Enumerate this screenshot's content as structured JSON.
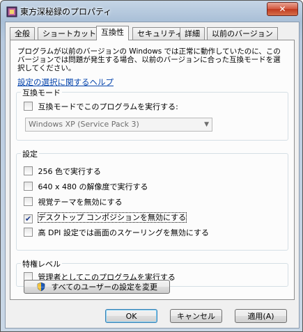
{
  "window": {
    "title": "東方深秘録のプロパティ",
    "close_label": "✕"
  },
  "tabs": [
    {
      "label": "全般"
    },
    {
      "label": "ショートカット"
    },
    {
      "label": "互換性"
    },
    {
      "label": "セキュリティ"
    },
    {
      "label": "詳細"
    },
    {
      "label": "以前のバージョン"
    }
  ],
  "compat": {
    "description": "プログラムが以前のバージョンの Windows では正常に動作していたのに、このバージョンでは問題が発生する場合、以前のバージョンに合った互換モードを選択してください。",
    "help_link": "設定の選択に関するヘルプ",
    "mode_group": {
      "label": "互換モード",
      "checkbox_label": "互換モードでこのプログラムを実行する:",
      "checked": false,
      "selected_os": "Windows XP (Service Pack 3)"
    },
    "settings_group": {
      "label": "設定",
      "items": [
        {
          "label": "256 色で実行する",
          "checked": false
        },
        {
          "label": "640 x 480 の解像度で実行する",
          "checked": false
        },
        {
          "label": "視覚テーマを無効にする",
          "checked": false
        },
        {
          "label": "デスクトップ コンポジションを無効にする",
          "checked": true
        },
        {
          "label": "高 DPI 設定では画面のスケーリングを無効にする",
          "checked": false
        }
      ]
    },
    "privilege_group": {
      "label": "特権レベル",
      "checkbox_label": "管理者としてこのプログラムを実行する",
      "checked": false
    },
    "all_users_button": "すべてのユーザーの設定を変更"
  },
  "footer": {
    "ok": "OK",
    "cancel": "キャンセル",
    "apply": "適用(A)"
  },
  "colors": {
    "accent_link": "#0645ad",
    "check_mark": "#1b3a8c"
  }
}
